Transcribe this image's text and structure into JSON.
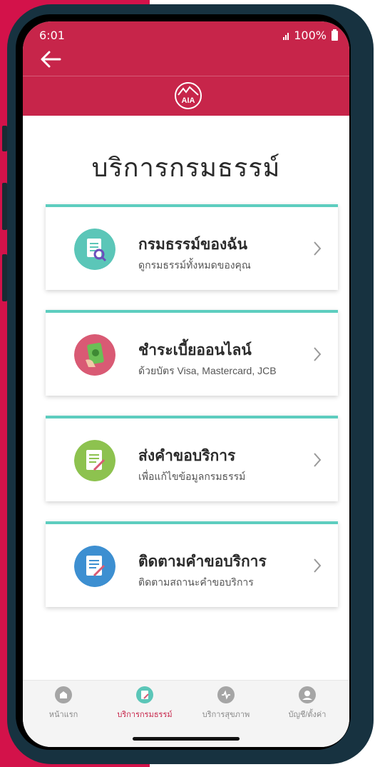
{
  "status": {
    "time": "6:01",
    "battery": "100%"
  },
  "page": {
    "title": "บริการกรมธรรม์"
  },
  "colors": {
    "brand_red": "#c7254a",
    "accent_teal": "#5dcdbf"
  },
  "cards": [
    {
      "title": "กรมธรรม์ของฉัน",
      "subtitle": "ดูกรมธรรม์ทั้งหมดของคุณ",
      "icon": "policy-search-icon",
      "icon_color": "#5bc6b8"
    },
    {
      "title": "ชำระเบี้ยออนไลน์",
      "subtitle": "ด้วยบัตร Visa, Mastercard, JCB",
      "icon": "payment-icon",
      "icon_color": "#d95a74"
    },
    {
      "title": "ส่งคำขอบริการ",
      "subtitle": "เพื่อแก้ไขข้อมูลกรมธรรม์",
      "icon": "request-form-icon",
      "icon_color": "#8dc24f"
    },
    {
      "title": "ติดตามคำขอบริการ",
      "subtitle": "ติดตามสถานะคำขอบริการ",
      "icon": "track-request-icon",
      "icon_color": "#3d8fd1"
    }
  ],
  "tabs": [
    {
      "label": "หน้าแรก",
      "icon": "home-icon"
    },
    {
      "label": "บริการกรมธรรม์",
      "icon": "policy-service-icon",
      "active": true
    },
    {
      "label": "บริการสุขภาพ",
      "icon": "health-icon"
    },
    {
      "label": "บัญชี/ตั้งค่า",
      "icon": "account-icon"
    }
  ]
}
